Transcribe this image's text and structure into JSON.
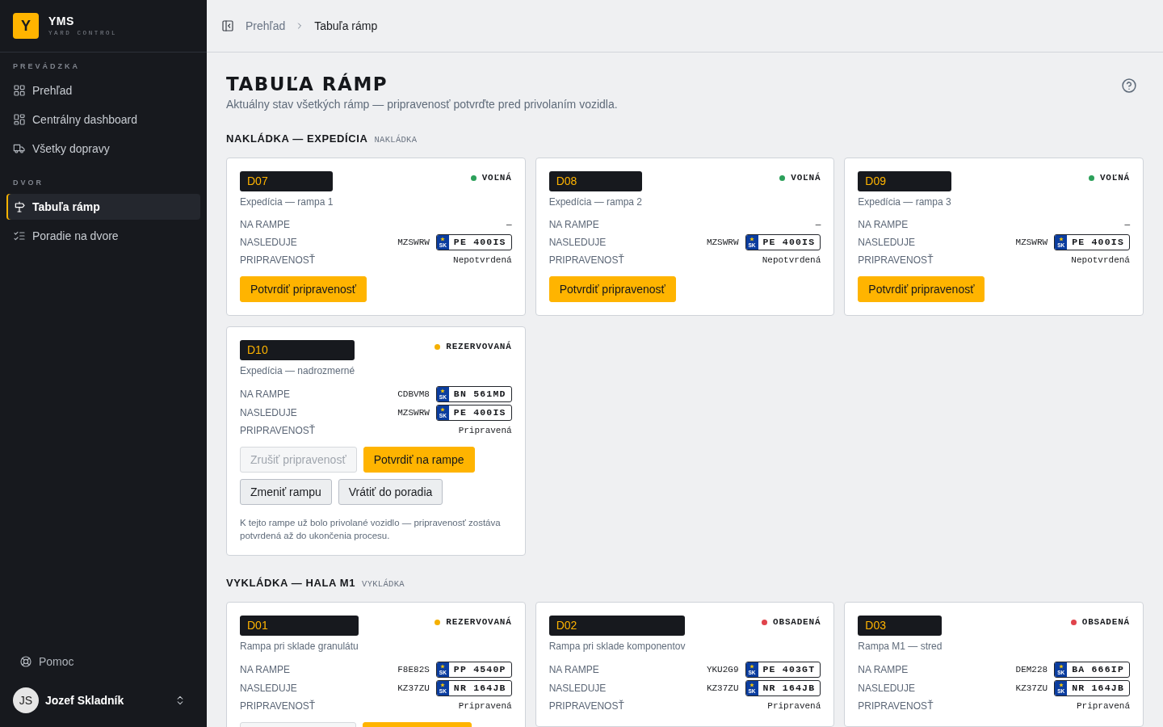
{
  "sidebar": {
    "brand": {
      "logo": "Y",
      "name": "YMS",
      "tagline": "YARD CONTROL"
    },
    "groups": [
      {
        "title": "PREVÁDZKA",
        "items": [
          {
            "label": "Prehľad",
            "selected": false
          },
          {
            "label": "Centrálny dashboard",
            "selected": false
          },
          {
            "label": "Všetky dopravy",
            "selected": false
          }
        ]
      },
      {
        "title": "DVOR",
        "items": [
          {
            "label": "Tabuľa rámp",
            "selected": true
          },
          {
            "label": "Poradie na dvore",
            "selected": false
          }
        ]
      }
    ],
    "help": {
      "label": "Pomoc"
    },
    "user": {
      "initials": "JS",
      "name": "Jozef Skladník"
    }
  },
  "breadcrumb": [
    {
      "label": "Prehľad",
      "current": false
    },
    {
      "label": "Tabuľa rámp",
      "current": true
    }
  ],
  "page": {
    "title": "TABUĽA RÁMP",
    "subtitle": "Aktuálny stav všetkých rámp — pripravenosť potvrďte pred privolaním vozidla."
  },
  "sections": [
    {
      "title": "NAKLÁDKA — EXPEDÍCIA",
      "tag": "NAKLÁDKA",
      "ramps": [
        {
          "id": "D07",
          "name": "Expedícia — rampa 1",
          "status": {
            "label": "VOĽNÁ",
            "color": "#2ca05a"
          },
          "rows": [
            {
              "kind": "text",
              "label": "NA RAMPE",
              "value": "—"
            },
            {
              "kind": "vehicle",
              "label": "NASLEDUJE",
              "code": "MZSWRW",
              "plate": {
                "country": "SK",
                "number": "PE 400IS"
              }
            },
            {
              "kind": "text",
              "label": "PRIPRAVENOSŤ",
              "value": "Nepotvrdená"
            }
          ],
          "actions": [
            {
              "buttons": [
                {
                  "label": "Potvrdiť pripravenosť",
                  "kind": "primary",
                  "disabled": false
                }
              ]
            }
          ]
        },
        {
          "id": "D08",
          "name": "Expedícia — rampa 2",
          "status": {
            "label": "VOĽNÁ",
            "color": "#2ca05a"
          },
          "rows": [
            {
              "kind": "text",
              "label": "NA RAMPE",
              "value": "—"
            },
            {
              "kind": "vehicle",
              "label": "NASLEDUJE",
              "code": "MZSWRW",
              "plate": {
                "country": "SK",
                "number": "PE 400IS"
              }
            },
            {
              "kind": "text",
              "label": "PRIPRAVENOSŤ",
              "value": "Nepotvrdená"
            }
          ],
          "actions": [
            {
              "buttons": [
                {
                  "label": "Potvrdiť pripravenosť",
                  "kind": "primary",
                  "disabled": false
                }
              ]
            }
          ]
        },
        {
          "id": "D09",
          "name": "Expedícia — rampa 3",
          "status": {
            "label": "VOĽNÁ",
            "color": "#2ca05a"
          },
          "rows": [
            {
              "kind": "text",
              "label": "NA RAMPE",
              "value": "—"
            },
            {
              "kind": "vehicle",
              "label": "NASLEDUJE",
              "code": "MZSWRW",
              "plate": {
                "country": "SK",
                "number": "PE 400IS"
              }
            },
            {
              "kind": "text",
              "label": "PRIPRAVENOSŤ",
              "value": "Nepotvrdená"
            }
          ],
          "actions": [
            {
              "buttons": [
                {
                  "label": "Potvrdiť pripravenosť",
                  "kind": "primary",
                  "disabled": false
                }
              ]
            }
          ]
        },
        {
          "id": "D10",
          "name": "Expedícia — nadrozmerné",
          "status": {
            "label": "REZERVOVANÁ",
            "color": "#f5b000"
          },
          "rows": [
            {
              "kind": "vehicle",
              "label": "NA RAMPE",
              "code": "CDBVM8",
              "plate": {
                "country": "SK",
                "number": "BN 561MD"
              }
            },
            {
              "kind": "vehicle",
              "label": "NASLEDUJE",
              "code": "MZSWRW",
              "plate": {
                "country": "SK",
                "number": "PE 400IS"
              }
            },
            {
              "kind": "text",
              "label": "PRIPRAVENOSŤ",
              "value": "Pripravená"
            }
          ],
          "actions": [
            {
              "buttons": [
                {
                  "label": "Zrušiť pripravenosť",
                  "kind": "secondary",
                  "disabled": true
                },
                {
                  "label": "Potvrdiť na rampe",
                  "kind": "primary",
                  "disabled": false
                }
              ]
            },
            {
              "buttons": [
                {
                  "label": "Zmeniť rampu",
                  "kind": "secondary",
                  "disabled": false
                },
                {
                  "label": "Vrátiť do poradia",
                  "kind": "secondary",
                  "disabled": false
                }
              ]
            }
          ],
          "note": "K tejto rampe už bolo privolané vozidlo — pripravenosť zostáva potvrdená až do ukončenia procesu."
        }
      ]
    },
    {
      "title": "VYKLÁDKA — HALA M1",
      "tag": "VYKLÁDKA",
      "ramps": [
        {
          "id": "D01",
          "name": "Rampa pri sklade granulátu",
          "status": {
            "label": "REZERVOVANÁ",
            "color": "#f5b000"
          },
          "rows": [
            {
              "kind": "vehicle",
              "label": "NA RAMPE",
              "code": "F8E82S",
              "plate": {
                "country": "SK",
                "number": "PP 4540P"
              }
            },
            {
              "kind": "vehicle",
              "label": "NASLEDUJE",
              "code": "KZ37ZU",
              "plate": {
                "country": "SK",
                "number": "NR 164JB"
              }
            },
            {
              "kind": "text",
              "label": "PRIPRAVENOSŤ",
              "value": "Pripravená"
            }
          ],
          "actions": [
            {
              "buttons": [
                {
                  "kind": "secondary",
                  "disabled": true
                },
                {
                  "kind": "primary",
                  "disabled": false
                }
              ]
            }
          ]
        },
        {
          "id": "D02",
          "name": "Rampa pri sklade komponentov",
          "status": {
            "label": "OBSADENÁ",
            "color": "#e0434b"
          },
          "rows": [
            {
              "kind": "vehicle",
              "label": "NA RAMPE",
              "code": "YKU2G9",
              "plate": {
                "country": "SK",
                "number": "PE 403GT"
              }
            },
            {
              "kind": "vehicle",
              "label": "NASLEDUJE",
              "code": "KZ37ZU",
              "plate": {
                "country": "SK",
                "number": "NR 164JB"
              }
            },
            {
              "kind": "text",
              "label": "PRIPRAVENOSŤ",
              "value": "Pripravená"
            }
          ]
        },
        {
          "id": "D03",
          "name": "Rampa M1 — stred",
          "status": {
            "label": "OBSADENÁ",
            "color": "#e0434b"
          },
          "rows": [
            {
              "kind": "vehicle",
              "label": "NA RAMPE",
              "code": "DEM228",
              "plate": {
                "country": "SK",
                "number": "BA 666IP"
              }
            },
            {
              "kind": "vehicle",
              "label": "NASLEDUJE",
              "code": "KZ37ZU",
              "plate": {
                "country": "SK",
                "number": "NR 164JB"
              }
            },
            {
              "kind": "text",
              "label": "PRIPRAVENOSŤ",
              "value": "Pripravená"
            }
          ]
        }
      ]
    }
  ]
}
